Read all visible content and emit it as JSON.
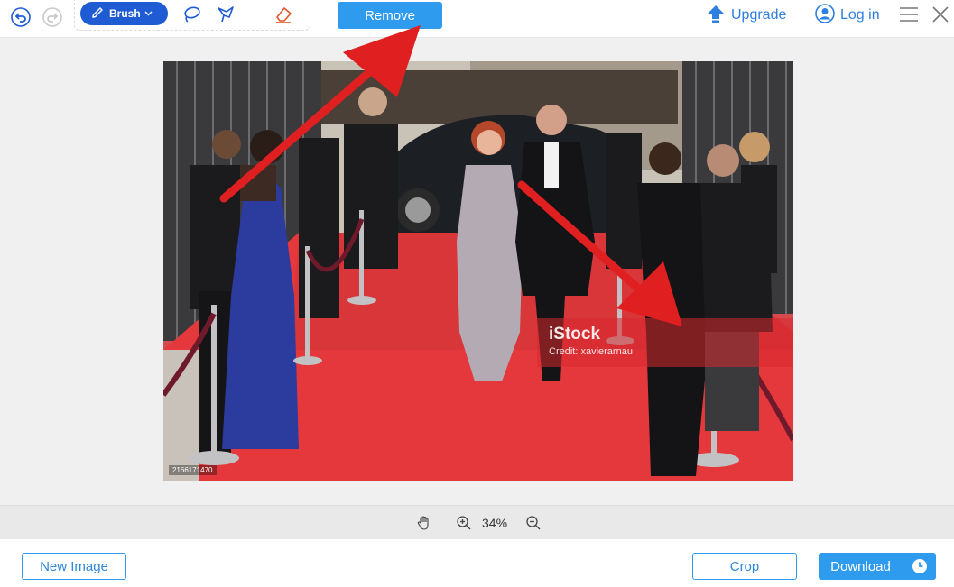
{
  "toolbar": {
    "undo_icon": "undo-icon",
    "redo_icon": "redo-icon",
    "brush_label": "Brush",
    "lasso_icon": "lasso-icon",
    "polygon_icon": "polygon-lasso-icon",
    "eraser_icon": "eraser-icon",
    "remove_label": "Remove",
    "upgrade_label": "Upgrade",
    "login_label": "Log in",
    "menu_icon": "hamburger-menu-icon",
    "close_icon": "close-icon"
  },
  "image": {
    "watermark_brand": "iStock",
    "watermark_credit": "Credit: xavierarnau",
    "stock_id": "2166171470"
  },
  "zoom": {
    "level": "34%",
    "hand_icon": "hand-pan-icon",
    "zoom_in_icon": "zoom-in-icon",
    "zoom_out_icon": "zoom-out-icon"
  },
  "bottom": {
    "new_image_label": "New Image",
    "crop_label": "Crop",
    "download_label": "Download",
    "history_icon": "clock-icon"
  },
  "colors": {
    "accent": "#2e9bef",
    "brush_active": "#1f5bd3",
    "link": "#2d7fe0",
    "annotation_arrow": "#e02020"
  }
}
